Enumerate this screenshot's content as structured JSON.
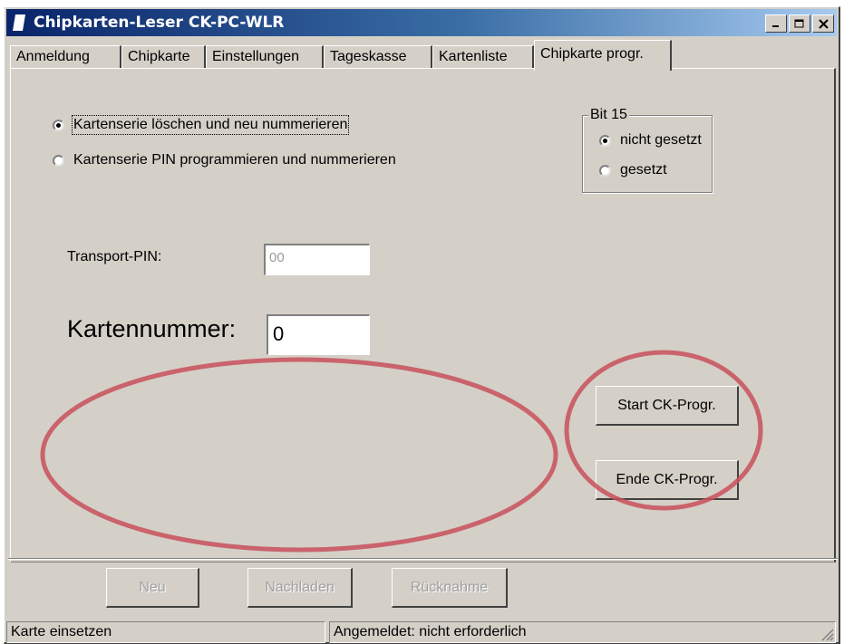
{
  "window": {
    "title": "Chipkarten-Leser CK-PC-WLR"
  },
  "tabs": [
    {
      "label": "Anmeldung"
    },
    {
      "label": "Chipkarte"
    },
    {
      "label": "Einstellungen"
    },
    {
      "label": "Tageskasse"
    },
    {
      "label": "Kartenliste"
    },
    {
      "label": "Chipkarte progr."
    }
  ],
  "mode": {
    "options": [
      {
        "label": "Kartenserie löschen und neu nummerieren",
        "checked": true
      },
      {
        "label": "Kartenserie PIN programmieren und nummerieren",
        "checked": false
      }
    ]
  },
  "bit15": {
    "legend": "Bit 15",
    "options": [
      {
        "label": "nicht gesetzt",
        "checked": true
      },
      {
        "label": "gesetzt",
        "checked": false
      }
    ]
  },
  "transport_pin": {
    "label": "Transport-PIN:",
    "value": "00"
  },
  "kartennummer": {
    "label": "Kartennummer:",
    "value": "0"
  },
  "buttons": {
    "start": "Start CK-Progr.",
    "ende": "Ende CK-Progr.",
    "neu": "Neu",
    "nachladen": "Nachladen",
    "ruecknahme": "Rücknahme"
  },
  "status": {
    "left": "Karte einsetzen",
    "right": "Angemeldet: nicht erforderlich"
  },
  "colors": {
    "annotation": "#c8505a",
    "titlebar": "#0a246a"
  }
}
